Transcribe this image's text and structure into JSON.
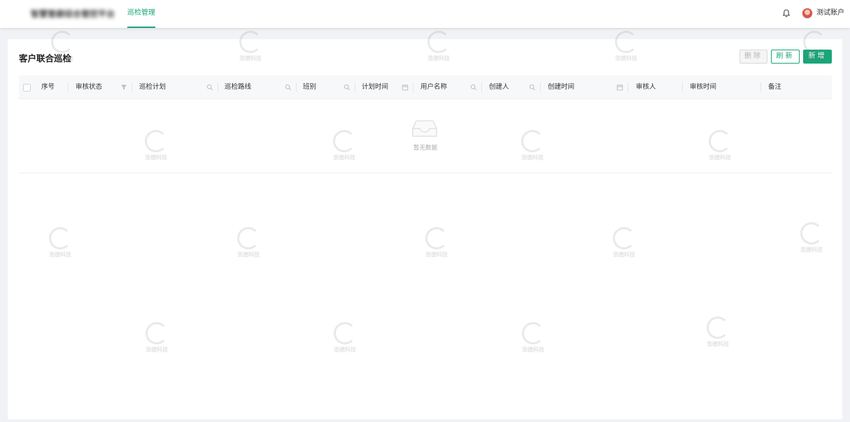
{
  "header": {
    "brand": "智慧管廊综合管控平台",
    "nav_tab": "巡检管理",
    "user_name": "测试账户"
  },
  "page": {
    "title": "客户联合巡检",
    "buttons": {
      "delete": "删除",
      "refresh": "刷新",
      "add": "新增"
    }
  },
  "table": {
    "columns": [
      "序号",
      "审核状态",
      "巡检计划",
      "巡检路线",
      "班别",
      "计划时间",
      "用户名称",
      "创建人",
      "创建时间",
      "审核人",
      "审核时间",
      "备注"
    ],
    "column_icons": [
      "",
      "filter-icon",
      "search-icon",
      "search-icon",
      "search-icon",
      "calendar-icon",
      "search-icon",
      "search-icon",
      "calendar-icon",
      "",
      "",
      ""
    ],
    "empty_text": "暂无数据"
  },
  "watermark": {
    "text": "浩德科技"
  },
  "colors": {
    "accent": "#1aa679",
    "background": "#f0f2f5"
  }
}
